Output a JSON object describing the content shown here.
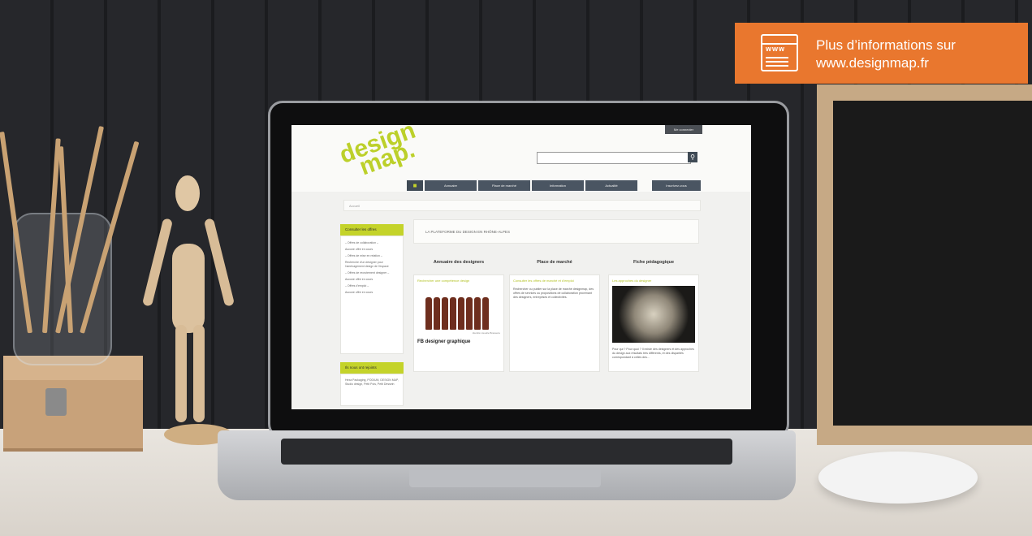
{
  "info_badge": {
    "line1": "Plus d’informations sur",
    "line2": "www.designmap.fr",
    "icon": "browser-www-icon",
    "icon_text": "www",
    "color": "#e9772e"
  },
  "site": {
    "login_label": "Me connecter",
    "logo_line1": "design",
    "logo_line2": "map.",
    "search": {
      "placeholder": "",
      "button_icon": "search-icon"
    },
    "nav": {
      "home_icon": "home-icon",
      "items": [
        "Annuaire",
        "Place de marché",
        "Information",
        "Actualité"
      ],
      "right_label": "Inscrivez-vous"
    },
    "breadcrumb": "Accueil",
    "banner": "LA PLATEFORME DU DESIGN EN RHÔNE-ALPES",
    "sidebar": {
      "head1": "Consulter les offres",
      "lines": [
        "– Offres de collaboration –",
        "Aucune offre en cours",
        "– Offres de mise en relation –",
        "Recherche d'un designer pour l'aménagement design de l'espace",
        "– Offres de recrutement designer –",
        "Aucune offre en cours",
        "– Offres d'emploi –",
        "Aucune offre en cours"
      ],
      "head2": "Ils nous ont rejoints",
      "joined": "Hexa Packaging, PODIUM, DESIGN MAP, Studio design, Petit Pois, Petit Dessein"
    },
    "columns": [
      {
        "title": "Annuaire des designers",
        "sub": "Rechercher une compétence design",
        "caption": "Identité visuelle Brasserie",
        "heading": "FB designer graphique"
      },
      {
        "title": "Place de marché",
        "sub": "Consulter les offres de marché et d'emploi",
        "text": "Rechercher ou publier sur la place de marché designmap, des offres de services ou propositions de collaboration provenant des designers, entreprises et collectivités."
      },
      {
        "title": "Fiche pédagogique",
        "sub": "Les approches du designer",
        "text": "Pour qui ? Pour quoi ? Il existe des designers et des approches du design aux résultats très différents, et des disparités correspondant à celles des…"
      }
    ]
  }
}
